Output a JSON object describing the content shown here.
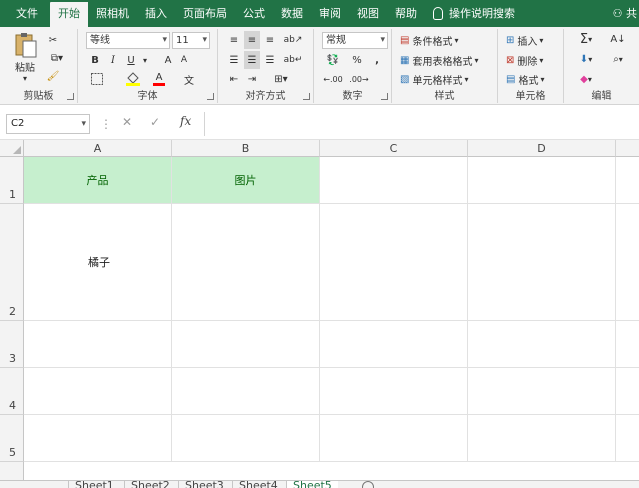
{
  "ribbon_tabs": [
    "文件",
    "开始",
    "照相机",
    "插入",
    "页面布局",
    "公式",
    "数据",
    "审阅",
    "视图",
    "帮助"
  ],
  "tell_me": "操作说明搜索",
  "share": "共",
  "clipboard": {
    "paste": "粘贴",
    "label": "剪贴板"
  },
  "font": {
    "name": "等线",
    "size": "11",
    "bold": "B",
    "italic": "I",
    "underline": "U",
    "grow": "A",
    "shrink": "A",
    "color_a": "A",
    "label": "字体"
  },
  "alignment": {
    "label": "对齐方式"
  },
  "number": {
    "format": "常规",
    "percent": "%",
    "comma": ",",
    "label": "数字"
  },
  "styles": {
    "conditional": "条件格式",
    "table": "套用表格格式",
    "cell": "单元格样式",
    "label": "样式"
  },
  "cells": {
    "insert": "插入",
    "delete": "删除",
    "format": "格式",
    "label": "单元格"
  },
  "editing": {
    "sum": "Σ",
    "label": "编辑"
  },
  "formula_bar": {
    "name_box": "C2",
    "fx": "fx",
    "cancel": "✕",
    "enter": "✓",
    "value": ""
  },
  "columns": [
    "A",
    "B",
    "C",
    "D"
  ],
  "rows": [
    "1",
    "2",
    "3",
    "4",
    "5"
  ],
  "cells_data": {
    "A1": "产品",
    "B1": "图片",
    "A2": "橘子"
  },
  "sheets": [
    "Sheet1",
    "Sheet2",
    "Sheet3",
    "Sheet4",
    "Sheet5"
  ],
  "active_sheet": "Sheet5",
  "colors": {
    "excel_green": "#217346",
    "header_fill": "#c6efce",
    "header_text": "#006100"
  }
}
